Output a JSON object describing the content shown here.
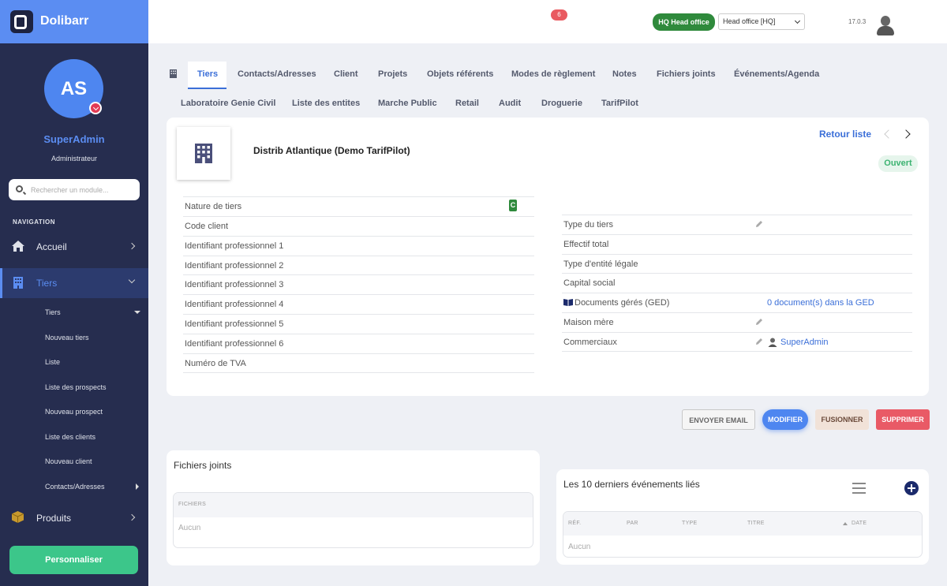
{
  "app": {
    "name": "Dolibarr",
    "logo_letter": "D"
  },
  "user": {
    "initials": "AS",
    "name": "SuperAdmin",
    "role": "Administrateur"
  },
  "search": {
    "placeholder": "Rechercher un module..."
  },
  "nav": {
    "heading": "NAVIGATION",
    "accueil": "Accueil",
    "tiers": "Tiers",
    "produits": "Produits",
    "sub_items": [
      "Tiers",
      "Nouveau tiers",
      "Liste",
      "Liste des prospects",
      "Nouveau prospect",
      "Liste des clients",
      "Nouveau client",
      "Contacts/Adresses"
    ]
  },
  "customize_button": "Personnaliser",
  "topbar": {
    "notifications": "6",
    "entity_badge": "HQ Head office",
    "entity_select": "Head office [HQ]",
    "version": "17.0.3"
  },
  "tabs": {
    "row1": [
      "Tiers",
      "Contacts/Adresses",
      "Client",
      "Projets",
      "Objets référents",
      "Modes de règlement",
      "Notes",
      "Fichiers joints",
      "Événements/Agenda"
    ],
    "row2": [
      "Laboratoire Genie Civil",
      "Liste des entites",
      "Marche Public",
      "Retail",
      "Audit",
      "Droguerie",
      "TarifPilot"
    ]
  },
  "company": {
    "name": "Distrib Atlantique (Demo TarifPilot)",
    "back_link": "Retour liste",
    "status": "Ouvert",
    "nature_badge": "C"
  },
  "fields_left": [
    "Nature de tiers",
    "Code client",
    "Identifiant professionnel 1",
    "Identifiant professionnel 2",
    "Identifiant professionnel 3",
    "Identifiant professionnel 4",
    "Identifiant professionnel 5",
    "Identifiant professionnel 6",
    "Numéro de TVA"
  ],
  "fields_right": {
    "labels": [
      "Type du tiers",
      "Effectif total",
      "Type d'entité légale",
      "Capital social",
      "Documents gérés (GED)",
      "Maison mère",
      "Commerciaux"
    ],
    "ged_value": "0 document(s) dans la GED",
    "sales_rep": "SuperAdmin"
  },
  "actions": {
    "email": "ENVOYER EMAIL",
    "edit": "MODIFIER",
    "merge": "FUSIONNER",
    "delete": "SUPPRIMER"
  },
  "files_panel": {
    "title": "Fichiers joints",
    "header": "FICHIERS",
    "empty": "Aucun"
  },
  "events_panel": {
    "title": "Les 10 derniers événements liés",
    "headers": [
      "RÉF.",
      "PAR",
      "TYPE",
      "TITRE",
      "DATE"
    ],
    "empty": "Aucun"
  },
  "colors": {
    "sidebar": "#262d4f",
    "accent": "#5b8df2",
    "success": "#3cc68a",
    "danger": "#e95a66"
  }
}
